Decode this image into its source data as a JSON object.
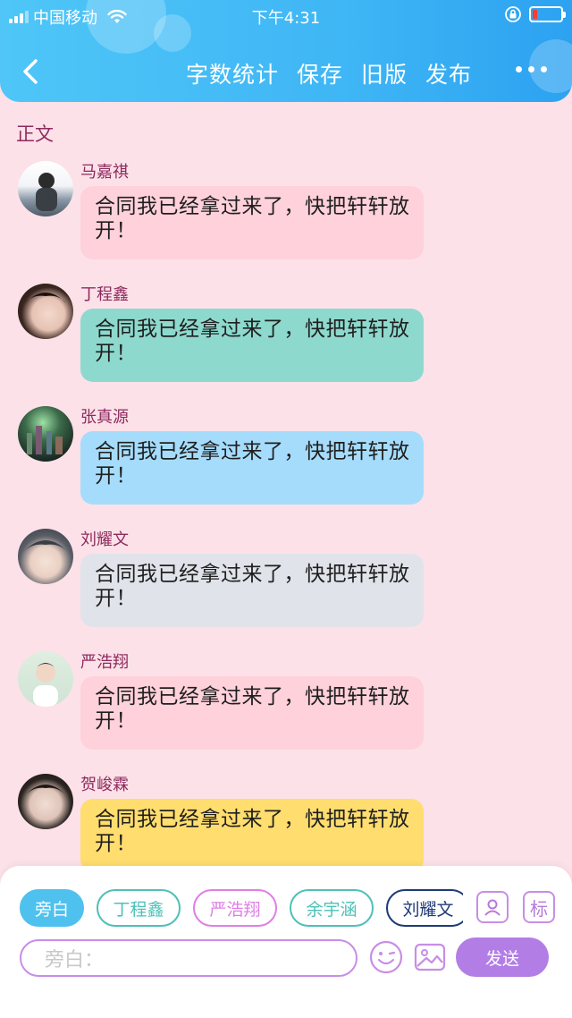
{
  "status_bar": {
    "carrier": "中国移动",
    "time": "下午4:31",
    "battery_level_percent": 15
  },
  "nav": {
    "actions": [
      "字数统计",
      "保存",
      "旧版",
      "发布"
    ]
  },
  "section_title": "正文",
  "messages": [
    {
      "sender": "马嘉祺",
      "text": "合同我已经拿过来了，快把轩轩放开！",
      "bubble_color": "#ffd1db"
    },
    {
      "sender": "丁程鑫",
      "text": "合同我已经拿过来了，快把轩轩放开！",
      "bubble_color": "#8ed9ce"
    },
    {
      "sender": "张真源",
      "text": "合同我已经拿过来了，快把轩轩放开！",
      "bubble_color": "#a6dcfb"
    },
    {
      "sender": "刘耀文",
      "text": "合同我已经拿过来了，快把轩轩放开！",
      "bubble_color": "#e1e3ea"
    },
    {
      "sender": "严浩翔",
      "text": "合同我已经拿过来了，快把轩轩放开！",
      "bubble_color": "#ffd1db"
    },
    {
      "sender": "贺峻霖",
      "text": "合同我已经拿过来了，快把轩轩放开！",
      "bubble_color": "#ffdd6e"
    }
  ],
  "bottom": {
    "chips": [
      {
        "label": "旁白",
        "color": "#4fc1ef",
        "filled": true
      },
      {
        "label": "丁程鑫",
        "color": "#4fc0b8",
        "filled": false
      },
      {
        "label": "严浩翔",
        "color": "#df7fe6",
        "filled": false
      },
      {
        "label": "余宇涵",
        "color": "#4fc0b8",
        "filled": false
      },
      {
        "label": "刘耀文",
        "color": "#1e3a78",
        "filled": false
      }
    ],
    "tag_label": "标",
    "input_placeholder": "旁白：",
    "send_label": "发送"
  },
  "colors": {
    "header": "#3fb6f5",
    "background": "#fce1e8",
    "name_text": "#8e2a5e",
    "accent_purple": "#b27ee6"
  },
  "icons": [
    "signal-icon",
    "wifi-icon",
    "lock-rotation-icon",
    "battery-icon",
    "back-arrow-icon",
    "more-icon",
    "person-card-icon",
    "tag-icon",
    "emoji-icon",
    "image-icon"
  ]
}
